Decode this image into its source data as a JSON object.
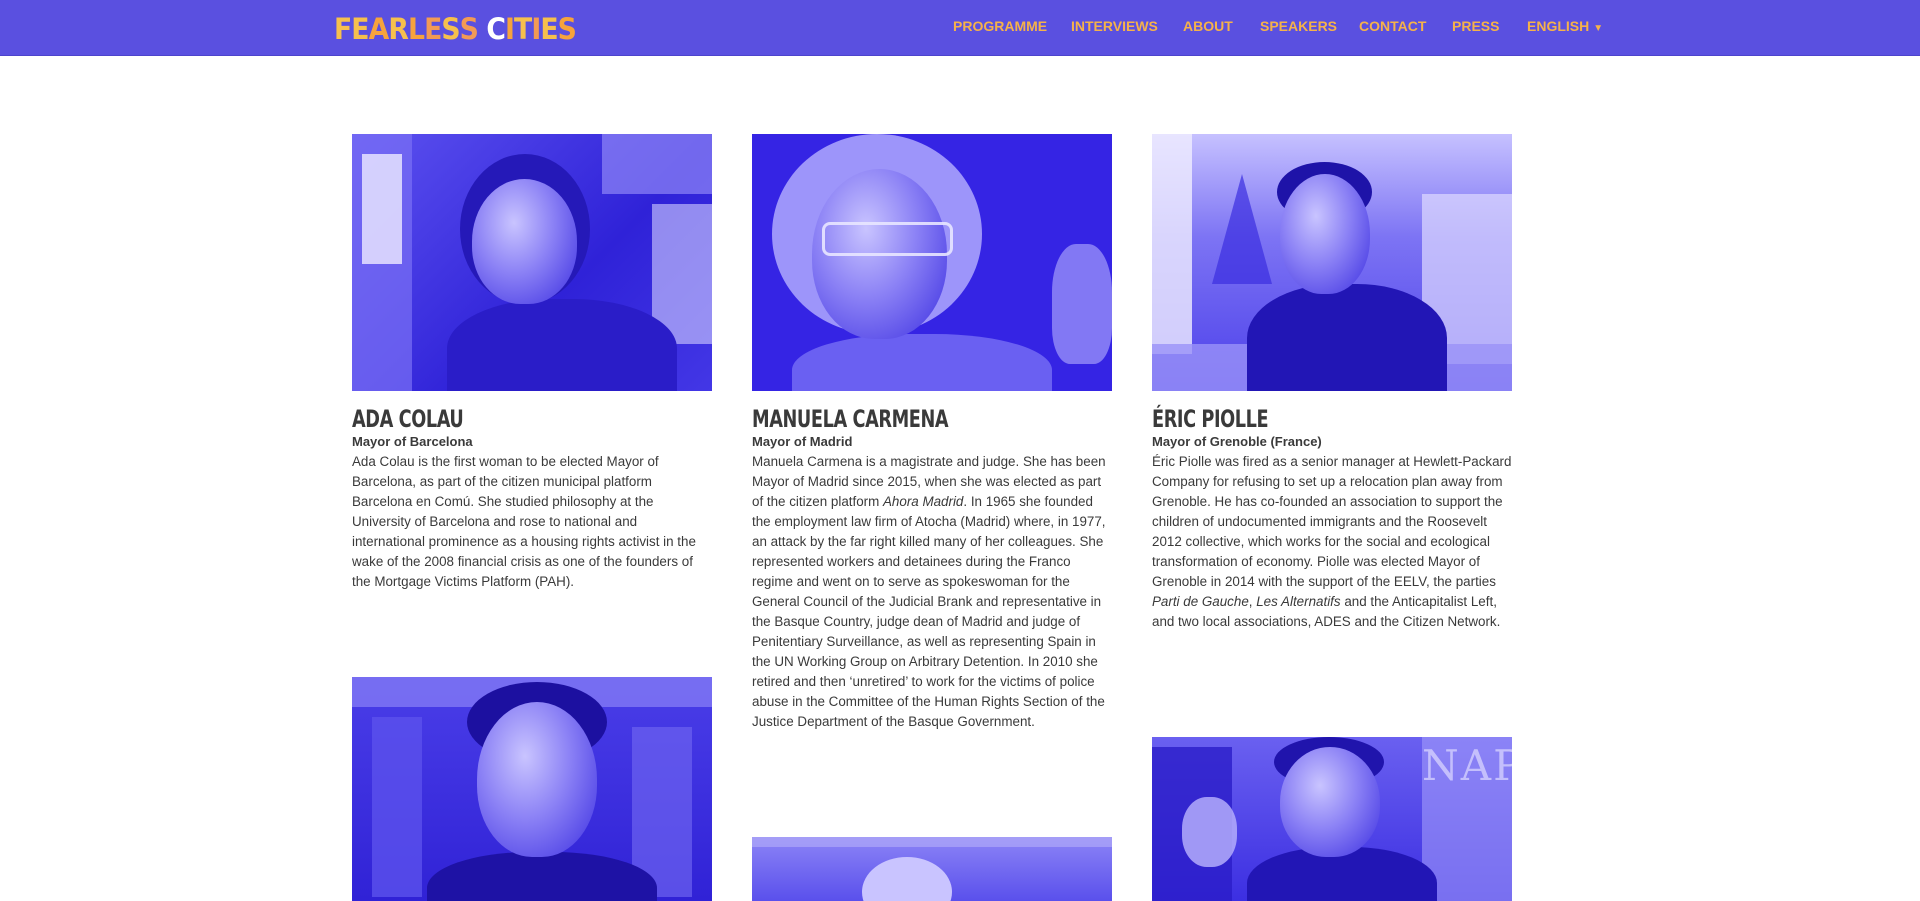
{
  "logo": {
    "text": "FEARLESS CITIES",
    "letters": [
      {
        "ch": "F",
        "color": "#f6c04d"
      },
      {
        "ch": "E",
        "color": "#f6c04d"
      },
      {
        "ch": "A",
        "color": "#f6a33c"
      },
      {
        "ch": "R",
        "color": "#f6c04d"
      },
      {
        "ch": "L",
        "color": "#f6a33c"
      },
      {
        "ch": "E",
        "color": "#f29a55"
      },
      {
        "ch": "S",
        "color": "#f6c04d"
      },
      {
        "ch": "S",
        "color": "#f29a55"
      },
      {
        "ch": " ",
        "color": "#ffffff"
      },
      {
        "ch": "C",
        "color": "#ffffff"
      },
      {
        "ch": "I",
        "color": "#f6a33c"
      },
      {
        "ch": "T",
        "color": "#f6c04d"
      },
      {
        "ch": "I",
        "color": "#f29a55"
      },
      {
        "ch": "E",
        "color": "#f6c04d"
      },
      {
        "ch": "S",
        "color": "#f6a33c"
      }
    ]
  },
  "nav": {
    "programme": "PROGRAMME",
    "interviews": "INTERVIEWS",
    "about": "ABOUT",
    "speakers": "SPEAKERS",
    "contact": "CONTACT",
    "press": "PRESS",
    "language": "ENGLISH"
  },
  "colors": {
    "topbar": "#5a50e0",
    "nav_text": "#f5b24a",
    "photo_tint": "#3b2be8",
    "text": "#3a3a3a"
  },
  "speakers": [
    {
      "name": "ADA COLAU",
      "role": "Mayor of Barcelona",
      "bio": "Ada Colau is the first woman to be elected Mayor of Barcelona, as part of the citizen municipal platform Barcelona en Comú. She studied philosophy at the University of Barcelona and rose to national and international prominence as a housing rights activist in the wake of the 2008 financial crisis as one of the founders of the Mortgage Victims Platform (PAH)."
    },
    {
      "name": "MANUELA CARMENA",
      "role": "Mayor of Madrid",
      "bio_parts": [
        "Manuela Carmena is a magistrate and judge. She has been Mayor of Madrid since 2015, when she was elected as part of the citizen platform ",
        "Ahora Madrid",
        ". In 1965 she founded the employment law firm of Atocha (Madrid) where, in 1977, an attack by the far right killed many of her colleagues. She represented workers and detainees during the Franco regime and went on to serve as spokeswoman for the General Council of the Judicial Brank and representative in the Basque Country, judge dean of Madrid and judge of Penitentiary Surveillance, as well as representing Spain in the UN Working Group on Arbitrary Detention. In 2010 she retired and then ‘unretired’ to work for the victims of police abuse in the Committee of the Human Rights Section of the Justice Department of the Basque Government."
      ]
    },
    {
      "name": "ÉRIC PIOLLE",
      "role": "Mayor of Grenoble (France)",
      "bio_parts": [
        "Éric Piolle was fired as a senior manager at Hewlett-Packard Company for refusing to set up a relocation plan away from Grenoble. He has co-founded an association to support the children of undocumented immigrants and the Roosevelt 2012 collective, which works for the social and ecological transformation of economy. Piolle was elected Mayor of Grenoble in 2014 with the support of the EELV, the parties ",
        "Parti de Gauche",
        ", ",
        "Les Alternatifs",
        " and the Anticapitalist Left, and two local associations, ADES and the Citizen Network."
      ]
    }
  ],
  "photo_overlay_text": "NAP"
}
